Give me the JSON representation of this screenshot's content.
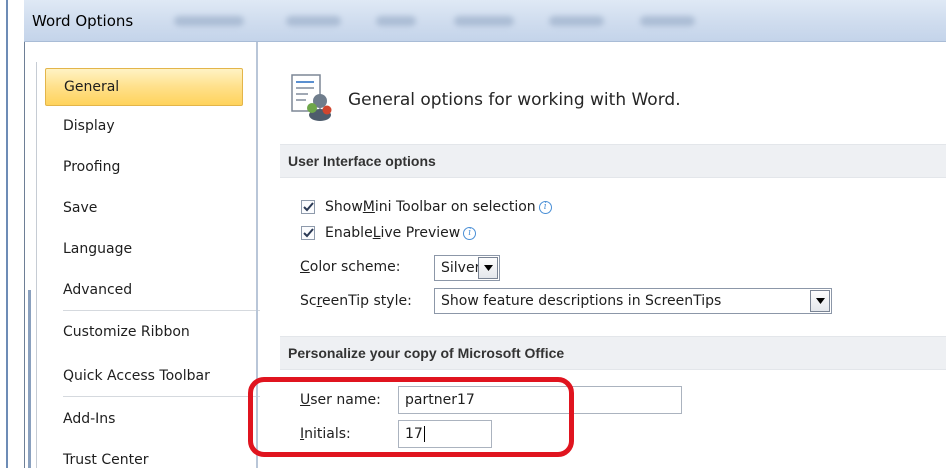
{
  "window": {
    "title": "Word Options"
  },
  "nav": {
    "items": [
      {
        "label": "General",
        "selected": true
      },
      {
        "label": "Display"
      },
      {
        "label": "Proofing"
      },
      {
        "label": "Save"
      },
      {
        "label": "Language"
      },
      {
        "label": "Advanced"
      },
      {
        "label": "Customize Ribbon"
      },
      {
        "label": "Quick Access Toolbar"
      },
      {
        "label": "Add-Ins"
      },
      {
        "label": "Trust Center"
      }
    ]
  },
  "general": {
    "header": "General options for working with Word.",
    "icon": "general-options-icon"
  },
  "ui_options": {
    "section_title": "User Interface options",
    "show_mini_toolbar": {
      "pre": "Show ",
      "accel": "M",
      "post": "ini Toolbar on selection",
      "checked": true
    },
    "enable_live_preview": {
      "pre": "Enable ",
      "accel": "L",
      "post": "ive Preview",
      "checked": true
    },
    "color_scheme": {
      "pre": "",
      "accel": "C",
      "post": "olor scheme:",
      "value": "Silver"
    },
    "screentip_style": {
      "pre": "Sc",
      "accel": "r",
      "post": "eenTip style:",
      "value": "Show feature descriptions in ScreenTips"
    }
  },
  "personalize": {
    "section_title": "Personalize your copy of Microsoft Office",
    "user_name": {
      "pre": "",
      "accel": "U",
      "post": "ser name:",
      "value": "partner17"
    },
    "initials": {
      "pre": "",
      "accel": "I",
      "post": "nitials:",
      "value": "17"
    }
  },
  "colors": {
    "highlight": "#e0141f",
    "selected_nav": "#ffd35c",
    "info_icon": "#4a8fd6"
  }
}
